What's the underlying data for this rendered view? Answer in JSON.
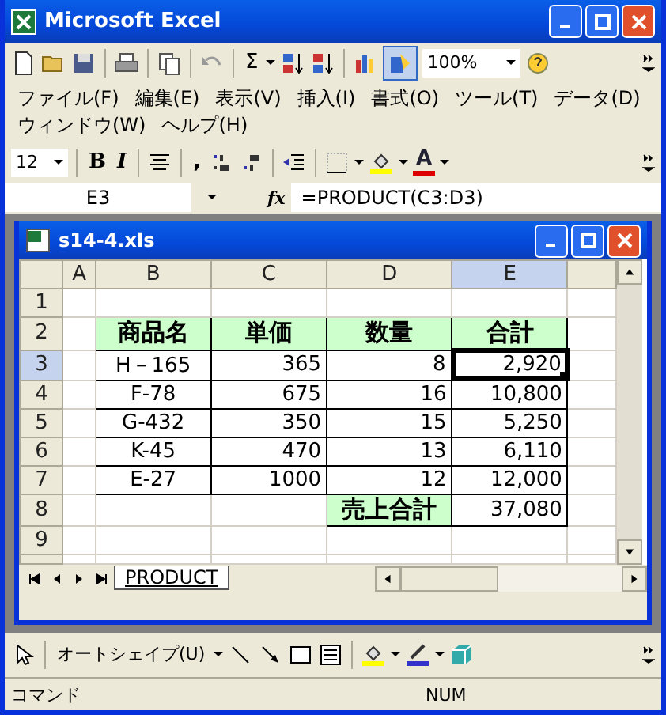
{
  "window": {
    "title": "Microsoft Excel"
  },
  "standard_toolbar": {
    "sum": "Σ",
    "zoom": "100%"
  },
  "menu": [
    "ファイル(F)",
    "編集(E)",
    "表示(V)",
    "挿入(I)",
    "書式(O)",
    "ツール(T)",
    "データ(D)",
    "ウィンドウ(W)",
    "ヘルプ(H)"
  ],
  "format_toolbar": {
    "font_size": "12",
    "bold": "B",
    "italic": "I",
    "comma": ",",
    "font_color": "A"
  },
  "formula_bar": {
    "name_box": "E3",
    "fx": "fx",
    "formula": "=PRODUCT(C3:D3)"
  },
  "workbook": {
    "title": "s14-4.xls",
    "columns": [
      {
        "label": "A",
        "selected": false
      },
      {
        "label": "B",
        "selected": false
      },
      {
        "label": "C",
        "selected": false
      },
      {
        "label": "D",
        "selected": false
      },
      {
        "label": "E",
        "selected": true
      }
    ],
    "rows": [
      {
        "header": "1",
        "selected": false,
        "cells": [
          {
            "kind": "empty",
            "selected": false
          },
          {
            "kind": "empty",
            "selected": false
          },
          {
            "kind": "empty",
            "selected": false
          },
          {
            "kind": "empty",
            "selected": false
          },
          {
            "kind": "empty",
            "selected": false
          }
        ]
      },
      {
        "header": "2",
        "selected": false,
        "cells": [
          {
            "kind": "empty",
            "selected": false
          },
          {
            "text": "商品名",
            "kind": "header",
            "selected": false
          },
          {
            "text": "単価",
            "kind": "header",
            "selected": false
          },
          {
            "text": "数量",
            "kind": "header",
            "selected": false
          },
          {
            "text": "合計",
            "kind": "header",
            "selected": false
          }
        ]
      },
      {
        "header": "3",
        "selected": true,
        "cells": [
          {
            "kind": "empty",
            "selected": false
          },
          {
            "text": "H－165",
            "kind": "name",
            "selected": false
          },
          {
            "text": "365",
            "kind": "number",
            "selected": false
          },
          {
            "text": "8",
            "kind": "number",
            "selected": false
          },
          {
            "text": "2,920",
            "kind": "number",
            "selected": true
          }
        ]
      },
      {
        "header": "4",
        "selected": false,
        "cells": [
          {
            "kind": "empty",
            "selected": false
          },
          {
            "text": "F-78",
            "kind": "name",
            "selected": false
          },
          {
            "text": "675",
            "kind": "number",
            "selected": false
          },
          {
            "text": "16",
            "kind": "number",
            "selected": false
          },
          {
            "text": "10,800",
            "kind": "number",
            "selected": false
          }
        ]
      },
      {
        "header": "5",
        "selected": false,
        "cells": [
          {
            "kind": "empty",
            "selected": false
          },
          {
            "text": "G-432",
            "kind": "name",
            "selected": false
          },
          {
            "text": "350",
            "kind": "number",
            "selected": false
          },
          {
            "text": "15",
            "kind": "number",
            "selected": false
          },
          {
            "text": "5,250",
            "kind": "number",
            "selected": false
          }
        ]
      },
      {
        "header": "6",
        "selected": false,
        "cells": [
          {
            "kind": "empty",
            "selected": false
          },
          {
            "text": "K-45",
            "kind": "name",
            "selected": false
          },
          {
            "text": "470",
            "kind": "number",
            "selected": false
          },
          {
            "text": "13",
            "kind": "number",
            "selected": false
          },
          {
            "text": "6,110",
            "kind": "number",
            "selected": false
          }
        ]
      },
      {
        "header": "7",
        "selected": false,
        "cells": [
          {
            "kind": "empty",
            "selected": false
          },
          {
            "text": "E-27",
            "kind": "name",
            "selected": false
          },
          {
            "text": "1000",
            "kind": "number",
            "selected": false
          },
          {
            "text": "12",
            "kind": "number",
            "selected": false
          },
          {
            "text": "12,000",
            "kind": "number",
            "selected": false
          }
        ]
      },
      {
        "header": "8",
        "selected": false,
        "cells": [
          {
            "kind": "empty",
            "selected": false
          },
          {
            "kind": "empty",
            "selected": false
          },
          {
            "kind": "empty",
            "selected": false
          },
          {
            "text": "売上合計",
            "kind": "header",
            "selected": false
          },
          {
            "text": "37,080",
            "kind": "number",
            "selected": false
          }
        ]
      },
      {
        "header": "9",
        "selected": false,
        "cells": [
          {
            "kind": "empty",
            "selected": false
          },
          {
            "kind": "empty",
            "selected": false
          },
          {
            "kind": "empty",
            "selected": false
          },
          {
            "kind": "empty",
            "selected": false
          },
          {
            "kind": "empty",
            "selected": false
          }
        ]
      }
    ],
    "sheet_tab": "PRODUCT"
  },
  "drawing_toolbar": {
    "autoshapes": "オートシェイプ(U)"
  },
  "status_bar": {
    "mode": "コマンド",
    "num": "NUM"
  }
}
